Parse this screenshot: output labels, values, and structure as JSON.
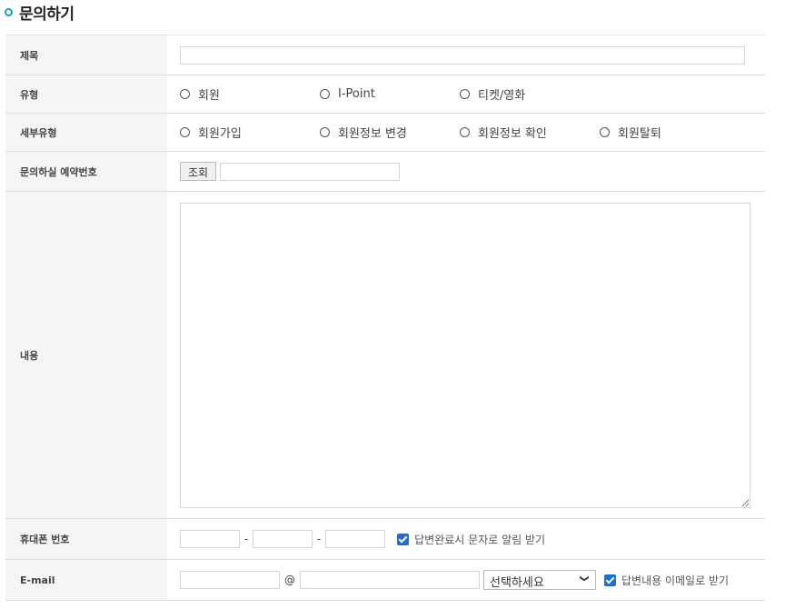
{
  "page": {
    "title": "문의하기"
  },
  "form": {
    "subject": {
      "label": "제목",
      "value": ""
    },
    "type": {
      "label": "유형",
      "options": [
        "회원",
        "I-Point",
        "티켓/영화"
      ]
    },
    "subtype": {
      "label": "세부유형",
      "options": [
        "회원가입",
        "회원정보 변경",
        "회원정보 확인",
        "회원탈퇴"
      ]
    },
    "reservation": {
      "label": "문의하실 예약번호",
      "button": "조회",
      "value": ""
    },
    "content": {
      "label": "내용",
      "value": ""
    },
    "phone": {
      "label": "휴대폰 번호",
      "sep": "-",
      "sms_label": "답변완료시 문자로 알림 받기",
      "sms_checked": true
    },
    "email": {
      "label": "E-mail",
      "at": "@",
      "domain_select": "선택하세요",
      "receive_label": "답변내용 이메일로 받기",
      "receive_checked": true
    }
  },
  "colors": {
    "accent": "#18a2b0",
    "checkbox": "#1a6ed8",
    "header_bg": "#f5f5f5"
  }
}
